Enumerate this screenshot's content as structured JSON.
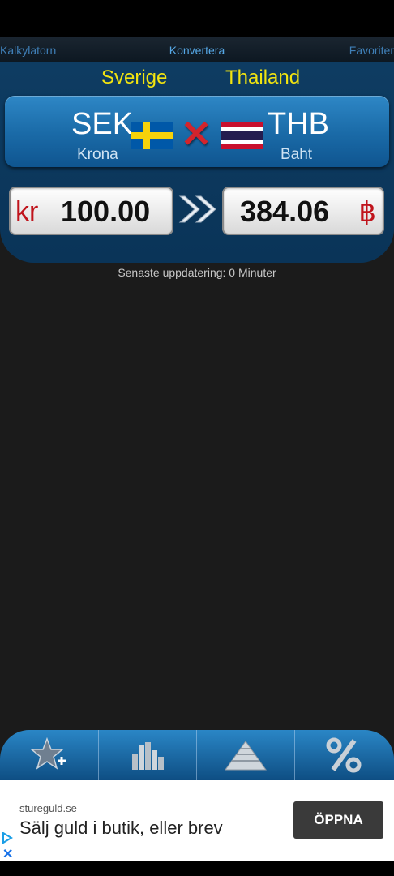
{
  "tabs": {
    "left": "Kalkylatorn",
    "middle": "Konvertera",
    "right": "Favoriter"
  },
  "converter": {
    "from": {
      "country": "Sverige",
      "code": "SEK",
      "name": "Krona",
      "symbol": "kr",
      "amount": "100.00"
    },
    "to": {
      "country": "Thailand",
      "code": "THB",
      "name": "Baht",
      "symbol": "฿",
      "amount": "384.06"
    },
    "swap_icon": "red-x-swap-icon",
    "arrow_icon": "double-chevron-right-icon"
  },
  "status": {
    "update_text": "Senaste uppdatering: 0 Minuter"
  },
  "toolbar": {
    "items": [
      {
        "icon": "star-add-icon"
      },
      {
        "icon": "bar-chart-icon"
      },
      {
        "icon": "pyramid-icon"
      },
      {
        "icon": "percent-icon"
      }
    ]
  },
  "ad": {
    "domain": "stureguld.se",
    "title": "Sälj guld i butik, eller brev",
    "button": "ÖPPNA"
  },
  "colors": {
    "accent": "#f2e410",
    "panel": "#1b6ca9",
    "symbol_red": "#c0141c"
  }
}
